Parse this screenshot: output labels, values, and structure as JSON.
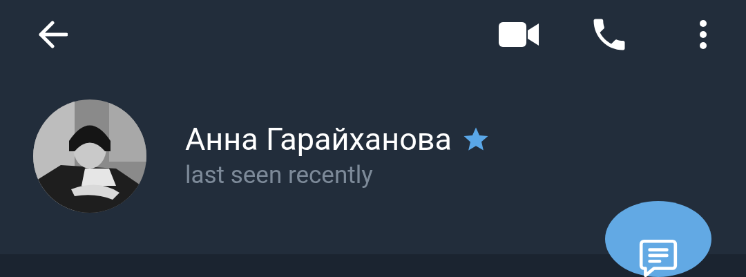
{
  "profile": {
    "name": "Анна Гарайханова",
    "premium": true,
    "status": "last seen recently"
  }
}
